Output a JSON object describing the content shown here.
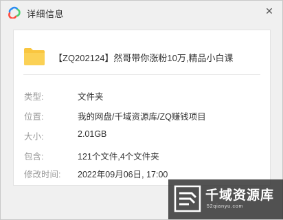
{
  "window": {
    "title": "详细信息",
    "close_label": "✕",
    "app_icon": "baidu-netdisk-cloud-icon",
    "accent_colors": [
      "#2a8cf2",
      "#ff4b3d",
      "#4ccf6f"
    ]
  },
  "file": {
    "icon": "folder-icon",
    "icon_color": "#f9c640",
    "name": "【ZQ202124】然哥带你涨粉10万,精品小白课"
  },
  "details": [
    {
      "label": "类型:",
      "value": "文件夹"
    },
    {
      "label": "位置:",
      "value": "我的网盘/千域资源库/ZQ赚钱项目"
    },
    {
      "label": "大小:",
      "value": "2.01GB"
    },
    {
      "label": "包含:",
      "value": "121个文件,4个文件夹"
    },
    {
      "label": "修改时间:",
      "value": "2022年09月06日, 17:00"
    }
  ],
  "watermark": {
    "title": "千域资源库",
    "url": "52qianyu.com",
    "logo": "qianyu-logo-icon"
  }
}
